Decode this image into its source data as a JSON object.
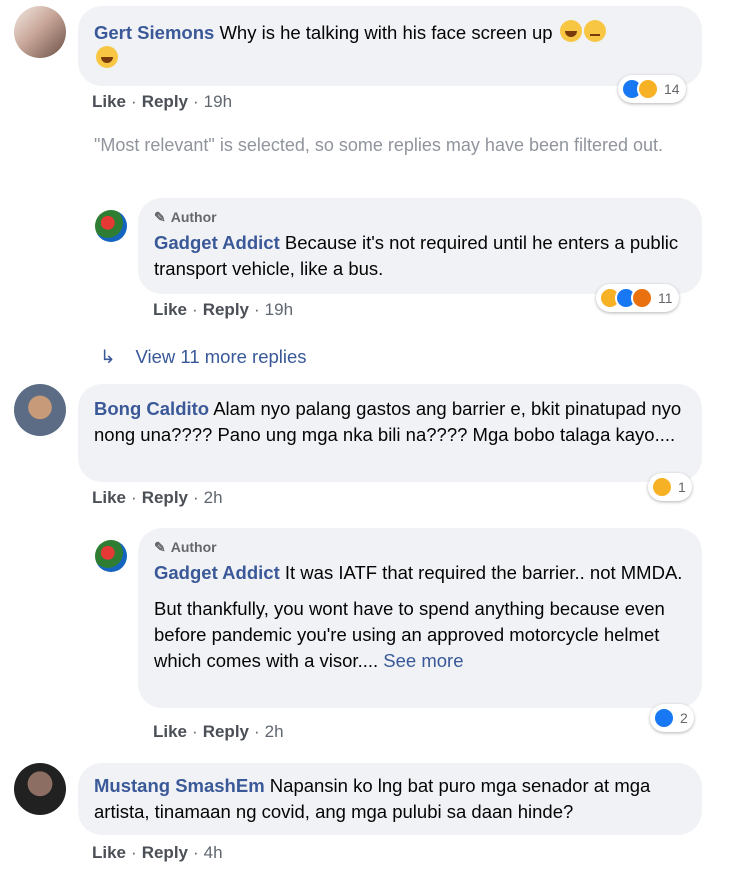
{
  "comments": [
    {
      "author": "Gert Siemons",
      "text": "Why is he talking with his face screen up",
      "actions": {
        "like": "Like",
        "reply": "Reply",
        "time": "19h"
      },
      "reaction_count": "14"
    },
    {
      "author": "Bong Caldito",
      "text": "Alam nyo palang gastos ang barrier e, bkit pinatupad nyo nong una???? Pano ung mga nka bili na???? Mga bobo talaga kayo....",
      "actions": {
        "like": "Like",
        "reply": "Reply",
        "time": "2h"
      },
      "reaction_count": "1"
    },
    {
      "author": "Mustang SmashEm",
      "text": "Napansin ko lng bat puro mga senador at mga artista, tinamaan ng covid, ang mga pulubi sa daan hinde?",
      "actions": {
        "like": "Like",
        "reply": "Reply",
        "time": "4h"
      }
    }
  ],
  "filter_notice": "\"Most relevant\" is selected, so some replies may have been filtered out.",
  "replies": [
    {
      "badge": "Author",
      "author": "Gadget Addict",
      "text": "Because it's not required until he enters a public transport vehicle, like a bus.",
      "actions": {
        "like": "Like",
        "reply": "Reply",
        "time": "19h"
      },
      "reaction_count": "11"
    },
    {
      "badge": "Author",
      "author": "Gadget Addict",
      "text": "It was IATF that required the barrier.. not MMDA.",
      "text2": "But thankfully, you wont have to spend anything because even before pandemic you're using an approved motorcycle helmet which comes with a visor....",
      "see_more": "See more",
      "actions": {
        "like": "Like",
        "reply": "Reply",
        "time": "2h"
      },
      "reaction_count": "2"
    }
  ],
  "view_more": "View 11 more replies",
  "colors": {
    "link": "#385898",
    "bubble": "#f0f2f5",
    "like_blue": "#1877f2",
    "angry": "#e9710f",
    "haha": "#f7b125"
  }
}
